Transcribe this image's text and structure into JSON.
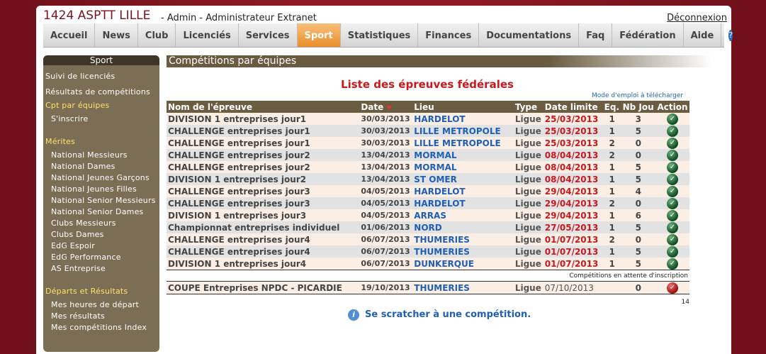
{
  "header": {
    "club": "1424 ASPTT LILLE",
    "subtitle": "- Admin - Administrateur Extranet",
    "logout": "Déconnexion"
  },
  "nav": {
    "items": [
      "Accueil",
      "News",
      "Club",
      "Licenciés",
      "Services",
      "Sport",
      "Statistiques",
      "Finances",
      "Documentations",
      "Faq",
      "Fédération",
      "Aide"
    ],
    "active": "Sport",
    "help_icon": "?"
  },
  "sidebar": {
    "title": "Sport",
    "links_top": [
      "Suivi de licenciés",
      "Résultats de compétitions"
    ],
    "cpt": "Cpt par équipes",
    "inscrire": "S'inscrire",
    "merites_title": "Mérites",
    "merites": [
      "National Messieurs",
      "National Dames",
      "National Jeunes Garçons",
      "National Jeunes Filles",
      "National Senior Messieurs",
      "National Senior Dames",
      "Clubs Messieurs",
      "Clubs Dames",
      "EdG Espoir",
      "EdG Performance",
      "AS Entreprise"
    ],
    "departs_title": "Départs et Résultats",
    "departs": [
      "Mes heures de départ",
      "Mes résultats",
      "Mes compétitions Index"
    ]
  },
  "main": {
    "section_title": "Compétitions par équipes",
    "list_title": "Liste des épreuves fédérales",
    "mode_emploi": "Mode d'emploi à télécharger",
    "columns": [
      "Nom de l'épreuve",
      "Date",
      "Lieu",
      "Type",
      "Date limite",
      "Eq.",
      "Nb Jou",
      "Action"
    ],
    "rows": [
      {
        "name": "DIVISION 1 entreprises jour1",
        "date": "30/03/2013",
        "lieu": "HARDELOT",
        "type": "Ligue",
        "limite": "25/03/2013",
        "eq": "1",
        "nb": "3"
      },
      {
        "name": "CHALLENGE entreprises jour1",
        "date": "30/03/2013",
        "lieu": "LILLE METROPOLE",
        "type": "Ligue",
        "limite": "25/03/2013",
        "eq": "1",
        "nb": "5"
      },
      {
        "name": "CHALLENGE entreprises jour1",
        "date": "30/03/2013",
        "lieu": "LILLE METROPOLE",
        "type": "Ligue",
        "limite": "25/03/2013",
        "eq": "2",
        "nb": "0"
      },
      {
        "name": "CHALLENGE entreprises jour2",
        "date": "13/04/2013",
        "lieu": "MORMAL",
        "type": "Ligue",
        "limite": "08/04/2013",
        "eq": "2",
        "nb": "0"
      },
      {
        "name": "CHALLENGE entreprises jour2",
        "date": "13/04/2013",
        "lieu": "MORMAL",
        "type": "Ligue",
        "limite": "08/04/2013",
        "eq": "1",
        "nb": "5"
      },
      {
        "name": "DIVISION 1 entreprises jour2",
        "date": "13/04/2013",
        "lieu": "ST OMER",
        "type": "Ligue",
        "limite": "08/04/2013",
        "eq": "1",
        "nb": "5"
      },
      {
        "name": "CHALLENGE entreprises jour3",
        "date": "04/05/2013",
        "lieu": "HARDELOT",
        "type": "Ligue",
        "limite": "29/04/2013",
        "eq": "1",
        "nb": "4"
      },
      {
        "name": "CHALLENGE entreprises jour3",
        "date": "04/05/2013",
        "lieu": "HARDELOT",
        "type": "Ligue",
        "limite": "29/04/2013",
        "eq": "2",
        "nb": "0"
      },
      {
        "name": "DIVISION 1 entreprises jour3",
        "date": "04/05/2013",
        "lieu": "ARRAS",
        "type": "Ligue",
        "limite": "29/04/2013",
        "eq": "1",
        "nb": "6"
      },
      {
        "name": "Championnat entreprises individuel",
        "date": "01/06/2013",
        "lieu": "NORD",
        "type": "Ligue",
        "limite": "27/05/2013",
        "eq": "1",
        "nb": "5"
      },
      {
        "name": "CHALLENGE entreprises jour4",
        "date": "06/07/2013",
        "lieu": "THUMERIES",
        "type": "Ligue",
        "limite": "01/07/2013",
        "eq": "2",
        "nb": "0"
      },
      {
        "name": "CHALLENGE entreprises jour4",
        "date": "06/07/2013",
        "lieu": "THUMERIES",
        "type": "Ligue",
        "limite": "01/07/2013",
        "eq": "1",
        "nb": "5"
      },
      {
        "name": "DIVISION 1 entreprises jour4",
        "date": "06/07/2013",
        "lieu": "DUNKERQUE",
        "type": "Ligue",
        "limite": "01/07/2013",
        "eq": "1",
        "nb": "5"
      }
    ],
    "pending_label": "Compétitions en attente d'inscription",
    "pending": {
      "name": "COUPE Entreprises NPDC - PICARDIE",
      "date": "19/10/2013",
      "lieu": "THUMERIES",
      "type": "Ligue",
      "limite": "07/10/2013",
      "eq": "",
      "nb": "0"
    },
    "count": "14",
    "scratch": "Se scratcher à une compétition.",
    "info_icon": "i",
    "check_icon": "✓"
  }
}
